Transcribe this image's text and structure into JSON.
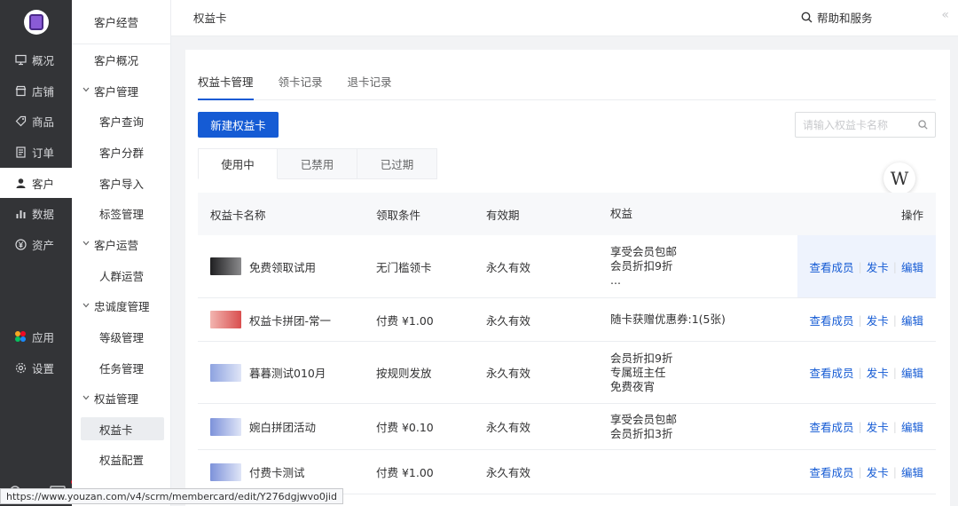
{
  "nav_primary": {
    "items": [
      {
        "label": "概况",
        "icon": "monitor-icon"
      },
      {
        "label": "店铺",
        "icon": "store-icon"
      },
      {
        "label": "商品",
        "icon": "tag-icon"
      },
      {
        "label": "订单",
        "icon": "list-icon"
      },
      {
        "label": "客户",
        "icon": "user-icon",
        "active": true
      },
      {
        "label": "数据",
        "icon": "bar-chart-icon"
      },
      {
        "label": "资产",
        "icon": "yen-icon"
      }
    ],
    "bottom_items": [
      {
        "label": "应用",
        "icon": "apps-icon"
      },
      {
        "label": "设置",
        "icon": "gear-icon"
      }
    ]
  },
  "nav_secondary": {
    "title": "客户经营",
    "items": [
      {
        "label": "客户概况",
        "type": "top"
      },
      {
        "label": "客户管理",
        "type": "group"
      },
      {
        "label": "客户查询",
        "type": "sub"
      },
      {
        "label": "客户分群",
        "type": "sub"
      },
      {
        "label": "客户导入",
        "type": "sub"
      },
      {
        "label": "标签管理",
        "type": "sub"
      },
      {
        "label": "客户运营",
        "type": "group"
      },
      {
        "label": "人群运营",
        "type": "sub"
      },
      {
        "label": "忠诚度管理",
        "type": "group"
      },
      {
        "label": "等级管理",
        "type": "sub"
      },
      {
        "label": "任务管理",
        "type": "sub"
      },
      {
        "label": "权益管理",
        "type": "group"
      },
      {
        "label": "权益卡",
        "type": "sub",
        "selected": true
      },
      {
        "label": "权益配置",
        "type": "sub"
      }
    ]
  },
  "header": {
    "breadcrumb": "权益卡",
    "help": "帮助和服务",
    "collapse": "«"
  },
  "tabs": [
    "权益卡管理",
    "领卡记录",
    "退卡记录"
  ],
  "toolbar": {
    "new_button": "新建权益卡",
    "search_placeholder": "请输入权益卡名称"
  },
  "status_tabs": [
    "使用中",
    "已禁用",
    "已过期"
  ],
  "float_badge": "W",
  "table": {
    "headers": [
      "权益卡名称",
      "领取条件",
      "有效期",
      "权益",
      "操作"
    ],
    "rows": [
      {
        "name": "免费领取试用",
        "condition": "无门槛领卡",
        "validity": "永久有效",
        "benefits": [
          "享受会员包邮",
          "会员折扣9折",
          "..."
        ],
        "thumb_color": "#3a3a3c",
        "highlight": true
      },
      {
        "name": "权益卡拼团-常一",
        "condition": "付费 ¥1.00",
        "validity": "永久有效",
        "benefits": [
          "随卡获赠优惠券:1(5张)"
        ],
        "thumb_color": "#e06a6a"
      },
      {
        "name": "暮暮测试010月",
        "condition": "按规则发放",
        "validity": "永久有效",
        "benefits": [
          "会员折扣9折",
          "专属班主任",
          "免费夜宵"
        ],
        "thumb_color": "#8ea3e0"
      },
      {
        "name": "婉白拼团活动",
        "condition": "付费 ¥0.10",
        "validity": "永久有效",
        "benefits": [
          "享受会员包邮",
          "会员折扣3折"
        ],
        "thumb_color": "#7d92da"
      },
      {
        "name": "付费卡测试",
        "condition": "付费 ¥1.00",
        "validity": "永久有效",
        "benefits": [],
        "thumb_color": "#7d92da"
      }
    ],
    "actions": [
      "查看成员",
      "发卡",
      "编辑"
    ]
  },
  "status_url": "https://www.youzan.com/v4/scrm/membercard/edit/Y276dgjwvo0jid",
  "colors": {
    "primary": "#155bd4",
    "sidebar_bg": "#333437"
  }
}
